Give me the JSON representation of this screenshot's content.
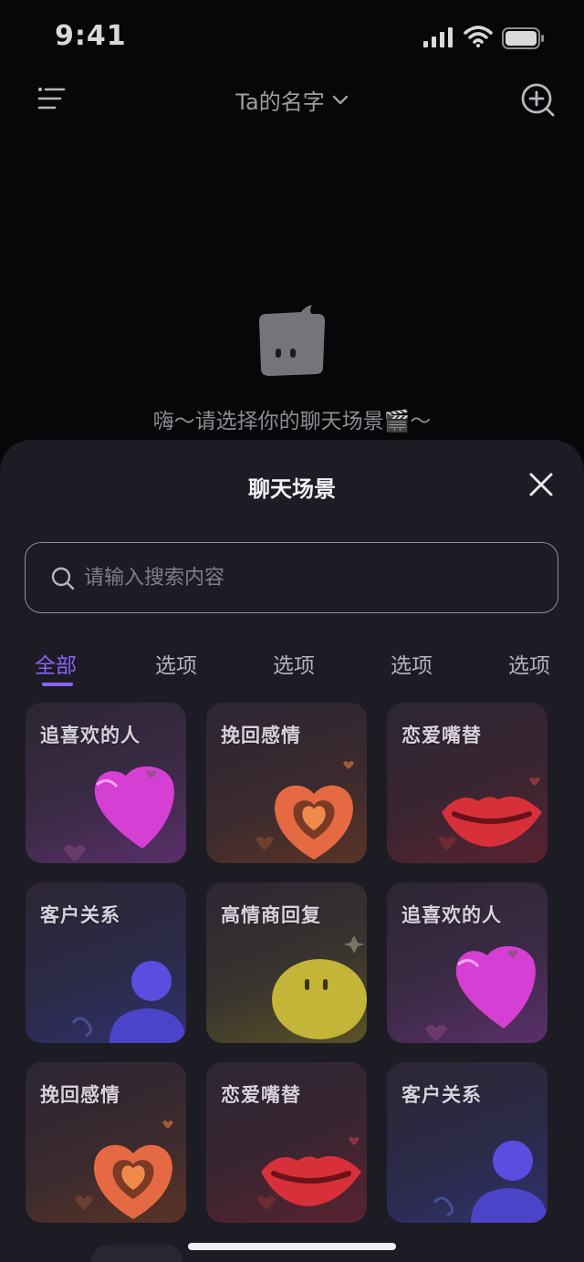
{
  "status_bar": {
    "time": "9:41"
  },
  "nav": {
    "title": "Ta的名字"
  },
  "empty_state": {
    "text": "嗨～请选择你的聊天场景🎬～"
  },
  "sheet": {
    "title": "聊天场景",
    "search": {
      "placeholder": "请输入搜索内容",
      "value": ""
    },
    "tabs": [
      {
        "label": "全部",
        "active": true
      },
      {
        "label": "选项",
        "active": false
      },
      {
        "label": "选项",
        "active": false
      },
      {
        "label": "选项",
        "active": false
      },
      {
        "label": "选项",
        "active": false
      }
    ],
    "cards": [
      {
        "label": "追喜欢的人",
        "art": "pink-heart"
      },
      {
        "label": "挽回感情",
        "art": "orange-heart"
      },
      {
        "label": "恋爱嘴替",
        "art": "red-lips"
      },
      {
        "label": "客户关系",
        "art": "blue-person"
      },
      {
        "label": "高情商回复",
        "art": "yellow-face"
      },
      {
        "label": "追喜欢的人",
        "art": "pink-heart"
      },
      {
        "label": "挽回感情",
        "art": "orange-heart"
      },
      {
        "label": "恋爱嘴替",
        "art": "red-lips"
      },
      {
        "label": "客户关系",
        "art": "blue-person"
      }
    ]
  },
  "colors": {
    "accent": "#8b63f5",
    "sheet_bg": "#1d1b24",
    "card_bg": "#2a2532"
  }
}
